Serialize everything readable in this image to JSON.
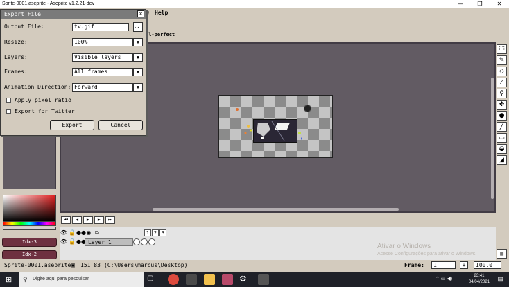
{
  "window": {
    "title": "Sprite-0001.aseprite - Aseprite v1.2.21-dev",
    "min": "—",
    "max": "❐",
    "close": "✕"
  },
  "menu": {
    "view_fragment": "w",
    "help": "Help"
  },
  "tab": {
    "pixel_perfect": "el-perfect"
  },
  "dialog": {
    "title": "Export File",
    "close": "✕",
    "output_file_label": "Output File:",
    "output_file_value": "tv.gif",
    "browse": "...",
    "resize_label": "Resize:",
    "resize_value": "100%",
    "layers_label": "Layers:",
    "layers_value": "Visible layers",
    "frames_label": "Frames:",
    "frames_value": "All frames",
    "anim_dir_label": "Animation Direction:",
    "anim_dir_value": "Forward",
    "apply_pixel_ratio": "Apply pixel ratio",
    "export_twitter": "Export for Twitter",
    "export_button": "Export",
    "cancel_button": "Cancel",
    "dropdown_glyph": "▼"
  },
  "palette": {
    "idx_3": "Idx-3",
    "idx_2": "Idx-2"
  },
  "timeline": {
    "layer_name": "Layer 1",
    "frames": [
      "1",
      "2",
      "3"
    ]
  },
  "status": {
    "filename": "Sprite-0001.aseprite",
    "coords": "151 83",
    "path": "(C:\\Users\\marcus\\Desktop)",
    "frame_label": "Frame:",
    "frame_value": "1",
    "plus": "+",
    "zoom": "100.0"
  },
  "watermark": {
    "title": "Ativar o Windows",
    "sub": "Acesse Configurações para ativar o Windows."
  },
  "taskbar": {
    "search_placeholder": "Digite aqui para pesquisar",
    "time": "23:41",
    "date": "04/04/2021"
  },
  "colors": {
    "workspace": "#625b63",
    "ui_bg": "#d3cbbe",
    "palette_btn": "#6e3040"
  }
}
